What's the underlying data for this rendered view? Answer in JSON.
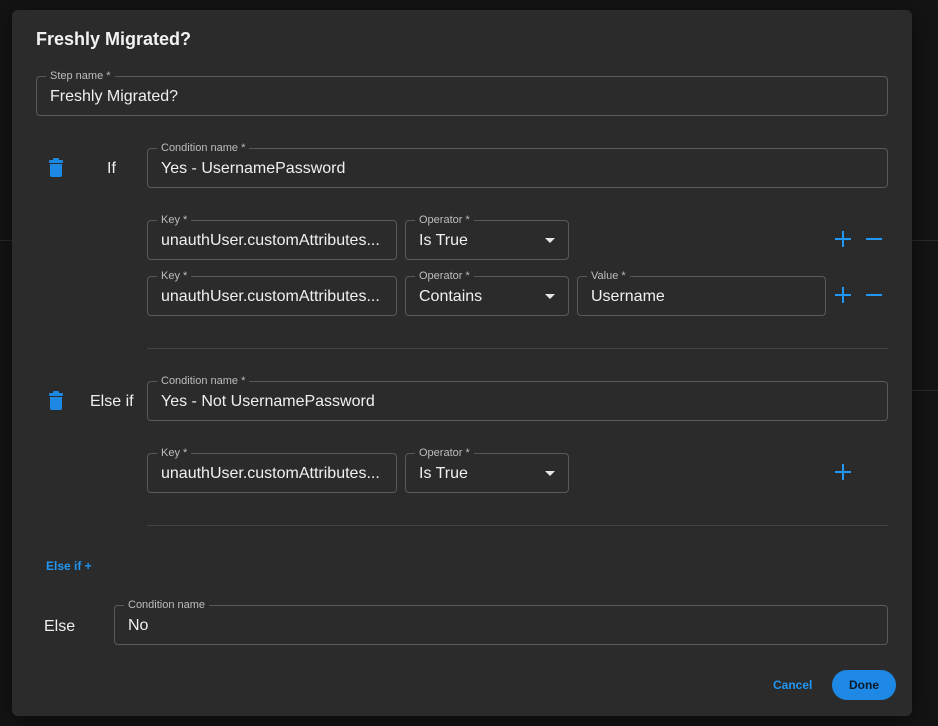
{
  "dialog": {
    "title": "Freshly Migrated?",
    "step_name": {
      "label": "Step name *",
      "value": "Freshly Migrated?"
    }
  },
  "if_block": {
    "keyword": "If",
    "delete_icon": "trash-icon",
    "condition_name": {
      "label": "Condition name *",
      "value": "Yes - UsernamePassword"
    },
    "rules": [
      {
        "key": {
          "label": "Key *",
          "value": "unauthUser.customAttributes..."
        },
        "operator": {
          "label": "Operator *",
          "value": "Is True"
        }
      },
      {
        "key": {
          "label": "Key *",
          "value": "unauthUser.customAttributes..."
        },
        "operator": {
          "label": "Operator *",
          "value": "Contains"
        },
        "value": {
          "label": "Value *",
          "value": "Username"
        }
      }
    ]
  },
  "else_if_block": {
    "keyword": "Else if",
    "delete_icon": "trash-icon",
    "condition_name": {
      "label": "Condition name *",
      "value": "Yes - Not UsernamePassword"
    },
    "rules": [
      {
        "key": {
          "label": "Key *",
          "value": "unauthUser.customAttributes..."
        },
        "operator": {
          "label": "Operator *",
          "value": "Is True"
        }
      }
    ]
  },
  "add_else_if": "Else if +",
  "else_block": {
    "keyword": "Else",
    "condition_name": {
      "label": "Condition name",
      "value": "No"
    }
  },
  "footer": {
    "cancel": "Cancel",
    "done": "Done"
  },
  "colors": {
    "accent": "#1e88e5",
    "dialog_bg": "#2b2b2b",
    "field_border": "#5a5a5a"
  }
}
